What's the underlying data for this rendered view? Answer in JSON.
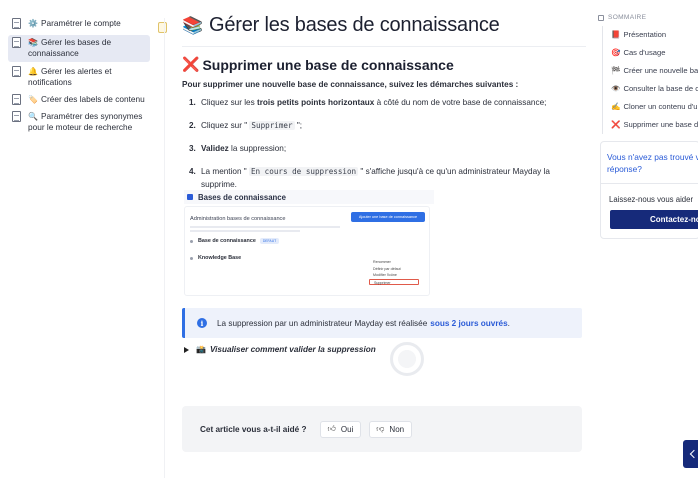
{
  "sidebar": {
    "items": [
      {
        "emoji": "⚙️",
        "label": "Paramétrer le compte"
      },
      {
        "emoji": "📚",
        "label": "Gérer les bases de connaissance",
        "active": true
      },
      {
        "emoji": "🔔",
        "label": "Gérer les alertes et notifications"
      },
      {
        "emoji": "🏷️",
        "label": "Créer des labels de contenu"
      },
      {
        "emoji": "🔍",
        "label": "Paramétrer des synonymes pour le moteur de recherche"
      }
    ]
  },
  "page": {
    "title_emoji": "📚",
    "title": "Gérer les bases de connaissance"
  },
  "section": {
    "icon": "❌",
    "title": "Supprimer une base de connaissance",
    "intro": "Pour supprimer une nouvelle base de connaissance, suivez les démarches suivantes :",
    "steps": [
      {
        "num": "1.",
        "pre": "Cliquez sur les ",
        "bold": "trois petits points horizontaux",
        "post": " à côté du nom de votre base de connaissance;"
      },
      {
        "num": "2.",
        "pre": "Cliquez sur \" ",
        "code": "Supprimer",
        "post": " \";"
      },
      {
        "num": "3.",
        "bold": "Validez",
        "post": " la suppression;"
      },
      {
        "num": "4.",
        "pre": "La mention \" ",
        "code": "En cours de suppression",
        "post": " \" s'affiche jusqu'à ce qu'un administrateur Mayday la supprime."
      }
    ]
  },
  "screenshot": {
    "header": "Bases de connaissance",
    "admin_title": "Administration bases de connaissance",
    "add_button": "Ajouter une base de connaissance",
    "row1": "Base de connaissance",
    "row1_badge": "DEFAUT",
    "row2": "Knowledge Base",
    "menu": [
      "Renommer",
      "Définir par défaut",
      "Modifier l'icône",
      "Supprimer"
    ]
  },
  "callout": {
    "text": "La suppression par un administrateur Mayday est réalisée",
    "link": "sous 2 jours ouvrés",
    "end": "."
  },
  "toggle": {
    "emoji": "📸",
    "label": "Visualiser comment valider la suppression"
  },
  "feedback": {
    "question": "Cet article vous a-t-il aidé ?",
    "yes": "Oui",
    "no": "Non"
  },
  "toc": {
    "header": "SOMMAIRE",
    "items": [
      {
        "emoji": "📕",
        "label": "Présentation"
      },
      {
        "emoji": "🎯",
        "label": "Cas d'usage"
      },
      {
        "emoji": "🏁",
        "label": "Créer une nouvelle base de connaissance"
      },
      {
        "emoji": "👁️",
        "label": "Consulter la base de connaissance"
      },
      {
        "emoji": "✍️",
        "label": "Cloner un contenu d'une base"
      },
      {
        "emoji": "❌",
        "label": "Supprimer une base de connaissance"
      }
    ]
  },
  "help": {
    "question": "Vous n'avez pas trouvé votre réponse?",
    "prompt": "Laissez-nous vous aider",
    "button": "Contactez-nous"
  },
  "colors": {
    "accent": "#2f6fe4",
    "link": "#2a5bd7",
    "cta": "#162a7a",
    "sidebar_active": "#e6e9f3"
  }
}
